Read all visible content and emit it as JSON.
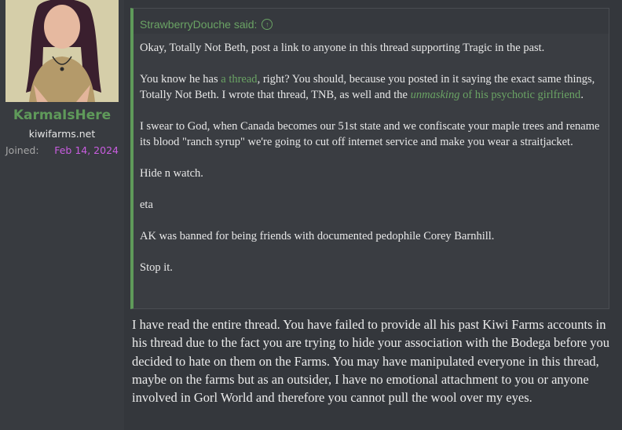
{
  "user": {
    "name": "KarmaIsHere",
    "title": "kiwifarms.net",
    "joined_label": "Joined:",
    "joined_date": "Feb 14, 2024"
  },
  "quote": {
    "author_said": "StrawberryDouche said:",
    "icon": "arrow-up-circle-icon",
    "p1": "Okay, Totally Not Beth, post a link to anyone in this thread supporting Tragic in the past.",
    "p2_pre": "You know he has ",
    "p2_link1": "a thread",
    "p2_mid": ", right? You should, because you posted in it saying the exact same things, Totally Not Beth. I wrote that thread, TNB, as well and the ",
    "p2_link2_italic": "unmasking",
    "p2_link2_rest": " of his psychotic girlfriend",
    "p2_end": ".",
    "p3": "I swear to God, when Canada becomes our 51st state and we confiscate your maple trees and rename its blood \"ranch syrup\" we're going to cut off internet service and make you wear a straitjacket.",
    "p4": "Hide n watch.",
    "p5": "eta",
    "p6": "AK was banned for being friends with documented pedophile Corey Barnhill.",
    "p7": "Stop it."
  },
  "reply_text": "I have read the entire thread. You have failed to provide all his past Kiwi Farms accounts in his thread due to the fact you are trying to hide your association with the Bodega before you decided to hate on them on the Farms. You may have manipulated everyone in this thread, maybe on the farms but as an outsider, I have no emotional attachment to you or anyone involved in Gorl World and therefore you cannot pull the wool over my eyes.",
  "colors": {
    "accent_green": "#5f9a5a",
    "date_purple": "#c95de0",
    "background": "#2f3136"
  }
}
